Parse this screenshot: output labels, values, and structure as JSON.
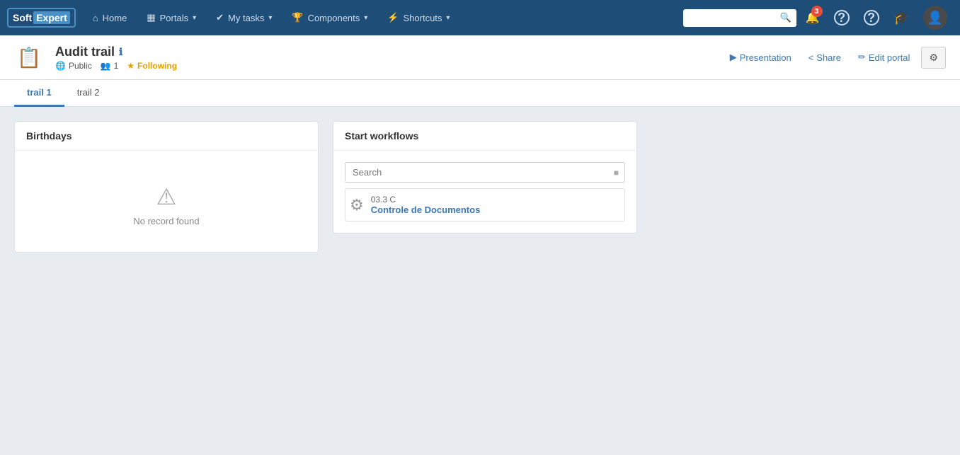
{
  "logo": {
    "soft": "Soft",
    "expert": "Expert"
  },
  "navbar": {
    "home_label": "Home",
    "portals_label": "Portals",
    "mytasks_label": "My tasks",
    "components_label": "Components",
    "shortcuts_label": "Shortcuts",
    "search_placeholder": "",
    "notification_count": "3"
  },
  "header": {
    "page_title": "Audit trail",
    "visibility": "Public",
    "followers": "1",
    "following_label": "Following",
    "presentation_label": "Presentation",
    "share_label": "Share",
    "edit_portal_label": "Edit portal"
  },
  "tabs": [
    {
      "label": "trail 1",
      "active": true
    },
    {
      "label": "trail 2",
      "active": false
    }
  ],
  "birthdays_widget": {
    "title": "Birthdays",
    "no_record": "No record found"
  },
  "workflows_widget": {
    "title": "Start workflows",
    "search_placeholder": "Search",
    "items": [
      {
        "code": "03.3 C",
        "name": "Controle de Documentos"
      }
    ]
  }
}
